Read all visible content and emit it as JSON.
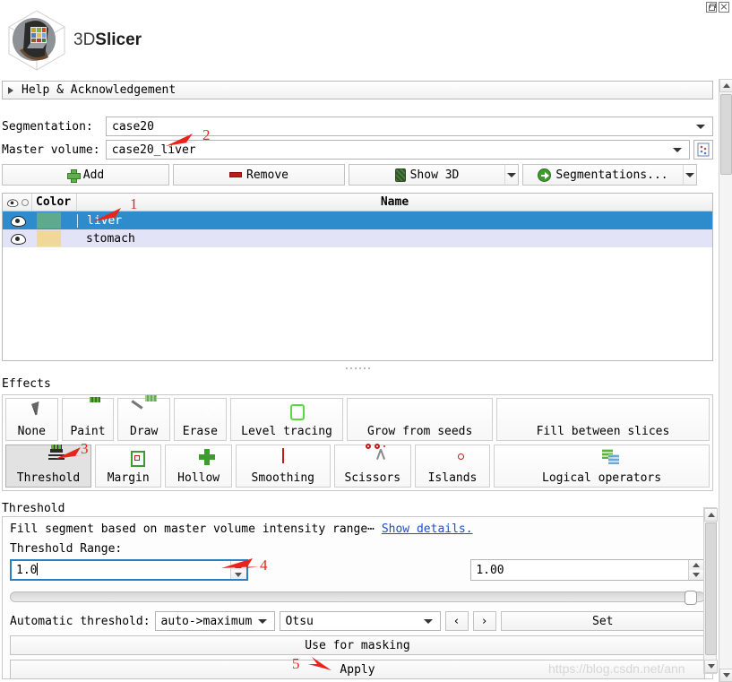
{
  "window": {
    "controls": [
      {
        "name": "restore-icon",
        "title": "Restore"
      },
      {
        "name": "close-icon",
        "title": "Close"
      }
    ]
  },
  "branding": {
    "logo_text_light": "3D",
    "logo_text_bold": "Slicer"
  },
  "help_section": {
    "label": "Help & Acknowledgement",
    "expander_icon": "triangle-right-icon"
  },
  "segmentation_row": {
    "label": "Segmentation:",
    "value": "case20"
  },
  "master_volume_row": {
    "label": "Master volume:",
    "value": "case20_liver",
    "side_button_icon": "volume-window-level-icon"
  },
  "actions": {
    "add": "Add",
    "remove": "Remove",
    "show3d": "Show 3D",
    "segmentations": "Segmentations..."
  },
  "segments_table": {
    "headers": {
      "visibility": "",
      "color": "Color",
      "name": "Name"
    },
    "rows": [
      {
        "name": "liver",
        "color": "#5fa98c",
        "visible": true,
        "selected": true
      },
      {
        "name": "stomach",
        "color": "#f0d79a",
        "visible": true,
        "selected": false
      }
    ]
  },
  "effects": {
    "section_label": "Effects",
    "row1": [
      {
        "label": "None",
        "icon": "cursor-arrow-icon",
        "active": false
      },
      {
        "label": "Paint",
        "icon": "paintbrush-icon",
        "active": false
      },
      {
        "label": "Draw",
        "icon": "pencil-draw-icon",
        "active": false
      },
      {
        "label": "Erase",
        "icon": "eraser-icon",
        "active": false
      },
      {
        "label": "Level tracing",
        "icon": "level-tracing-icon",
        "active": false
      },
      {
        "label": "Grow from seeds",
        "icon": "grow-from-seeds-icon",
        "active": false
      },
      {
        "label": "Fill between slices",
        "icon": "fill-between-slices-icon",
        "active": false
      }
    ],
    "row2": [
      {
        "label": "Threshold",
        "icon": "threshold-icon",
        "active": true
      },
      {
        "label": "Margin",
        "icon": "margin-icon",
        "active": false
      },
      {
        "label": "Hollow",
        "icon": "hollow-icon",
        "active": false
      },
      {
        "label": "Smoothing",
        "icon": "smoothing-icon",
        "active": false
      },
      {
        "label": "Scissors",
        "icon": "scissors-icon",
        "active": false
      },
      {
        "label": "Islands",
        "icon": "islands-icon",
        "active": false
      },
      {
        "label": "Logical operators",
        "icon": "logical-operators-icon",
        "active": false
      }
    ]
  },
  "threshold_panel": {
    "section_label": "Threshold",
    "description": "Fill segment based on master volume intensity range⋯",
    "details_link": "Show details.",
    "range_label": "Threshold Range:",
    "min_value": "1.0",
    "max_value": "1.00",
    "slider_percent": 99,
    "auto_label": "Automatic threshold:",
    "auto_mode": "auto->maximum",
    "auto_method": "Otsu",
    "prev_button": "‹",
    "next_button": "›",
    "set_button": "Set",
    "use_for_masking": "Use for masking",
    "apply_button": "Apply"
  },
  "annotations": [
    {
      "number": "1",
      "target": "liver segment row"
    },
    {
      "number": "2",
      "target": "master volume combo"
    },
    {
      "number": "3",
      "target": "threshold effect button"
    },
    {
      "number": "4",
      "target": "threshold minimum spinbox"
    },
    {
      "number": "5",
      "target": "apply button"
    }
  ],
  "watermark": "https://blog.csdn.net/ann",
  "colors": {
    "selection_blue": "#2e8ccd",
    "alt_row": "#e3e3f7",
    "annotation_red": "#e8241c",
    "link_blue": "#1a4fd0"
  }
}
